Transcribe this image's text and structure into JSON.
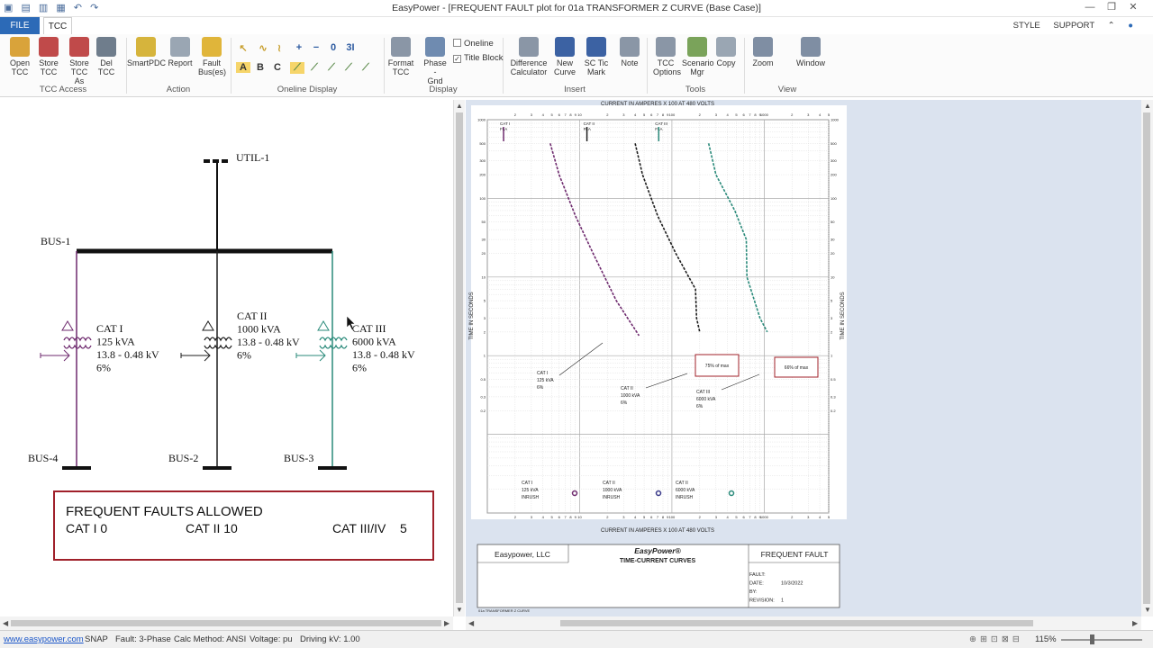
{
  "window": {
    "title": "EasyPower - [FREQUENT FAULT plot for 01a TRANSFORMER Z CURVE  (Base Case)]",
    "controls": [
      "—",
      "❐",
      "✕"
    ]
  },
  "tabs": {
    "file": "FILE",
    "tcc": "TCC",
    "style": "STYLE",
    "support": "SUPPORT"
  },
  "ribbon": {
    "buttons": [
      {
        "label": "Open\nTCC",
        "icon": "folder-icon",
        "color": "#d9a33a"
      },
      {
        "label": "Store\nTCC",
        "icon": "store-icon",
        "color": "#c04a4a"
      },
      {
        "label": "Store\nTCC As",
        "icon": "store-as-icon",
        "color": "#c04a4a"
      },
      {
        "label": "Del\nTCC",
        "icon": "delete-icon",
        "color": "#6f7d8c"
      },
      {
        "label": "SmartPDC",
        "icon": "smartpdc-icon",
        "color": "#d6b43c"
      },
      {
        "label": "Report",
        "icon": "report-icon",
        "color": "#9aa6b3"
      },
      {
        "label": "Fault\nBus(es)",
        "icon": "fault-icon",
        "color": "#e0b53a"
      },
      {
        "label": "Format\nTCC",
        "icon": "format-icon",
        "color": "#8a96a6"
      },
      {
        "label": "Phase -\nGnd",
        "icon": "phase-gnd-icon",
        "color": "#6f8bb0"
      },
      {
        "label": "Difference\nCalculator",
        "icon": "calculator-icon",
        "color": "#8a96a6"
      },
      {
        "label": "New\nCurve",
        "icon": "new-curve-icon",
        "color": "#3c62a3"
      },
      {
        "label": "SC Tic\nMark",
        "icon": "sc-tic-icon",
        "color": "#3c62a3"
      },
      {
        "label": "Note",
        "icon": "note-icon",
        "color": "#8a96a6"
      },
      {
        "label": "TCC\nOptions",
        "icon": "options-icon",
        "color": "#8a96a6"
      },
      {
        "label": "Scenario\nMgr",
        "icon": "scenario-icon",
        "color": "#7aa35a"
      },
      {
        "label": "Copy",
        "icon": "copy-icon",
        "color": "#9aa6b3"
      },
      {
        "label": "Zoom",
        "icon": "zoom-icon",
        "color": "#7f8ea3"
      },
      {
        "label": "Window",
        "icon": "window-icon",
        "color": "#7f8ea3"
      }
    ],
    "groups": [
      "TCC Access",
      "Action",
      "Oneline Display",
      "Display",
      "Insert",
      "Tools",
      "View"
    ],
    "oneline_tools_row1": [
      "+",
      "−",
      "0",
      "3I"
    ],
    "oneline_tools_row2": [
      "A",
      "B",
      "C"
    ],
    "checkboxes": [
      {
        "label": "Oneline",
        "checked": false
      },
      {
        "label": "Title Block",
        "checked": true
      }
    ]
  },
  "oneline": {
    "util": "UTIL-1",
    "bus1": "BUS-1",
    "bus2": "BUS-2",
    "bus3": "BUS-3",
    "bus4": "BUS-4",
    "xfmr1": [
      "CAT I",
      "125 kVA",
      "13.8 - 0.48 kV",
      "6%"
    ],
    "xfmr2": [
      "CAT II",
      "1000 kVA",
      "13.8 - 0.48 kV",
      "6%"
    ],
    "xfmr3": [
      "CAT III",
      "6000 kVA",
      "13.8 - 0.48 kV",
      "6%"
    ],
    "colors": {
      "cat1": "#6e2a6e",
      "cat2": "#1d1d1d",
      "cat3": "#2a8a7a"
    }
  },
  "faultbox": {
    "title": "FREQUENT FAULTS ALLOWED",
    "cat1": "CAT I  0",
    "cat2": "CAT II  10",
    "cat3": "CAT III/IV    5"
  },
  "tcc": {
    "top_label": "CURRENT IN AMPERES X 100 AT 480 VOLTS",
    "bottom_label": "CURRENT IN AMPERES X 100 AT 480 VOLTS",
    "y_label": "TIME IN SECONDS",
    "y_ticks": [
      "1000",
      "500",
      "300",
      "200",
      "100",
      "50",
      "30",
      "20",
      "10",
      "5",
      "3",
      "2",
      "1",
      "0.5",
      "0.3",
      "0.2"
    ],
    "x_ticks": [
      "2",
      "3",
      "4",
      "5",
      "6",
      "7",
      "8",
      "9",
      "10",
      "2",
      "3",
      "4",
      "5",
      "6",
      "7",
      "8",
      "9",
      "100",
      "2",
      "3",
      "4",
      "5",
      "6",
      "7",
      "8",
      "9",
      "1000",
      "2",
      "3",
      "4",
      "5"
    ],
    "fla_labels": [
      "CAT I\nFLA",
      "CAT II\nFLA",
      "CAT III\nFLA"
    ],
    "curve_labels": [
      [
        "CAT I",
        "125 kVA",
        "6%"
      ],
      [
        "CAT II",
        "1000 kVA",
        "6%"
      ],
      [
        "CAT III",
        "6000 kVA",
        "6%"
      ]
    ],
    "inrush_labels": [
      [
        "CAT I",
        "125 kVA",
        "INRUSH"
      ],
      [
        "CAT II",
        "1000 kVA",
        "INRUSH"
      ],
      [
        "CAT II",
        "6000 kVA",
        "INRUSH"
      ]
    ],
    "notes": [
      "75% of max",
      "66% of max"
    ]
  },
  "titleblock": {
    "company": "Easypower, LLC",
    "brand": "EasyPower®",
    "subtitle": "TIME-CURRENT CURVES",
    "plot_name": "FREQUENT FAULT",
    "fields": [
      {
        "k": "FAULT:",
        "v": ""
      },
      {
        "k": "DATE:",
        "v": "10/3/2022"
      },
      {
        "k": "BY:",
        "v": ""
      },
      {
        "k": "REVISION:",
        "v": "1"
      }
    ],
    "footer": "01a TRANSFORMER Z CURVE"
  },
  "status": {
    "link": "www.easypower.com",
    "snap": "SNAP",
    "fault": "Fault: 3-Phase",
    "calc": "Calc Method: ANSI",
    "voltage": "Voltage: pu",
    "driving": "Driving kV: 1.00",
    "zoom": "115%"
  }
}
